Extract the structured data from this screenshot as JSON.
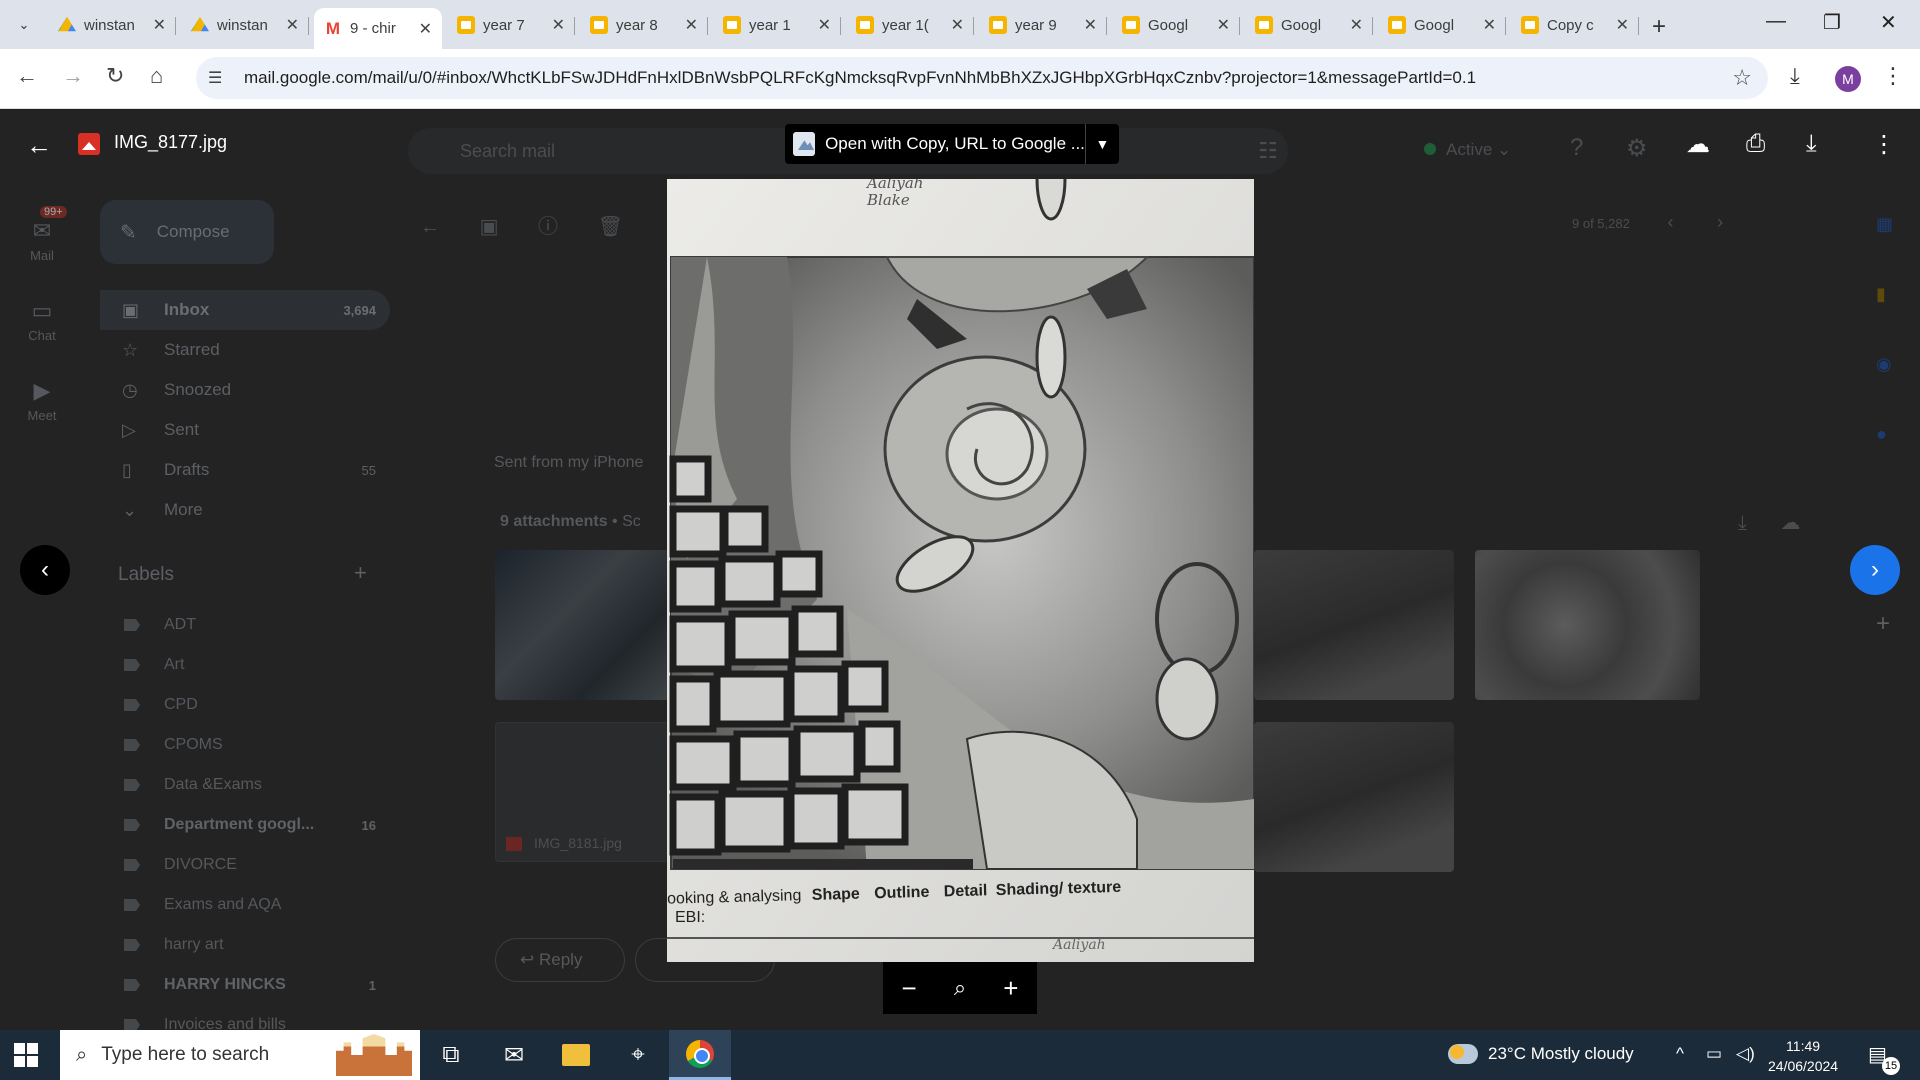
{
  "browser": {
    "tabs": [
      {
        "title": "winstan",
        "favicon": "drive-icon",
        "active": false
      },
      {
        "title": "winstan",
        "favicon": "drive-icon",
        "active": false
      },
      {
        "title": "9 - chir",
        "favicon": "gmail-icon",
        "active": true
      },
      {
        "title": "year 7",
        "favicon": "slides-icon",
        "active": false
      },
      {
        "title": "year 8",
        "favicon": "slides-icon",
        "active": false
      },
      {
        "title": "year 1",
        "favicon": "slides-icon",
        "active": false
      },
      {
        "title": "year 1(",
        "favicon": "slides-icon",
        "active": false
      },
      {
        "title": "year 9",
        "favicon": "slides-icon",
        "active": false
      },
      {
        "title": "Googl",
        "favicon": "slides-icon",
        "active": false
      },
      {
        "title": "Googl",
        "favicon": "slides-icon",
        "active": false
      },
      {
        "title": "Googl",
        "favicon": "slides-icon",
        "active": false
      },
      {
        "title": "Copy c",
        "favicon": "slides-icon",
        "active": false
      }
    ],
    "url": "mail.google.com/mail/u/0/#inbox/WhctKLbFSwJDHdFnHxlDBnWsbPQLRFcKgNmcksqRvpFvnNhMbBhXZxJGHbpXGrbHqxCznbv?projector=1&messagePartId=0.1",
    "profile_initial": "M"
  },
  "viewer": {
    "filename": "IMG_8177.jpg",
    "open_with_label": "Open with Copy, URL to Google ...",
    "sketch": {
      "top_names": "Aaliyah\nBlake",
      "criteria_prefix": "ooking & analysing",
      "criteria_items": [
        "Shape",
        "Outline",
        "Detail",
        "Shading/ texture"
      ],
      "ebi_label": "EBI:",
      "bottom_name": "Aaliyah"
    }
  },
  "gmail": {
    "app_name": "Gmail",
    "rail": [
      {
        "label": "Mail",
        "badge": "99+"
      },
      {
        "label": "Chat"
      },
      {
        "label": "Meet"
      }
    ],
    "compose_label": "Compose",
    "search_placeholder": "Search mail",
    "status": "Active",
    "folders": [
      {
        "label": "Inbox",
        "count": "3,694",
        "selected": true
      },
      {
        "label": "Starred",
        "count": ""
      },
      {
        "label": "Snoozed",
        "count": ""
      },
      {
        "label": "Sent",
        "count": ""
      },
      {
        "label": "Drafts",
        "count": "55"
      },
      {
        "label": "More",
        "count": ""
      }
    ],
    "labels_title": "Labels",
    "labels": [
      {
        "label": "ADT",
        "count": "",
        "bold": false
      },
      {
        "label": "Art",
        "count": "",
        "bold": false
      },
      {
        "label": "CPD",
        "count": "",
        "bold": false
      },
      {
        "label": "CPOMS",
        "count": "",
        "bold": false
      },
      {
        "label": "Data &Exams",
        "count": "",
        "bold": false
      },
      {
        "label": "Department googl...",
        "count": "16",
        "bold": true
      },
      {
        "label": "DIVORCE",
        "count": "",
        "bold": false
      },
      {
        "label": "Exams and AQA",
        "count": "",
        "bold": false
      },
      {
        "label": "harry art",
        "count": "",
        "bold": false
      },
      {
        "label": "HARRY HINCKS",
        "count": "1",
        "bold": true
      },
      {
        "label": "Invoices and bills",
        "count": "",
        "bold": false
      }
    ],
    "pager": "9 of 5,282",
    "message_body": "Sent from my iPhone",
    "attachments_header": "9 attachments",
    "attachments_suffix": "• Sc",
    "attachment_file": "IMG_8181.jpg",
    "reply_label": "Reply"
  },
  "taskbar": {
    "search_placeholder": "Type here to search",
    "weather": "23°C  Mostly cloudy",
    "time": "11:49",
    "date": "24/06/2024",
    "notifications": "15"
  },
  "colors": {
    "viewer_bg": "#1f1f1f",
    "next_button": "#1a73e8",
    "taskbar": "#1c2b3a"
  }
}
